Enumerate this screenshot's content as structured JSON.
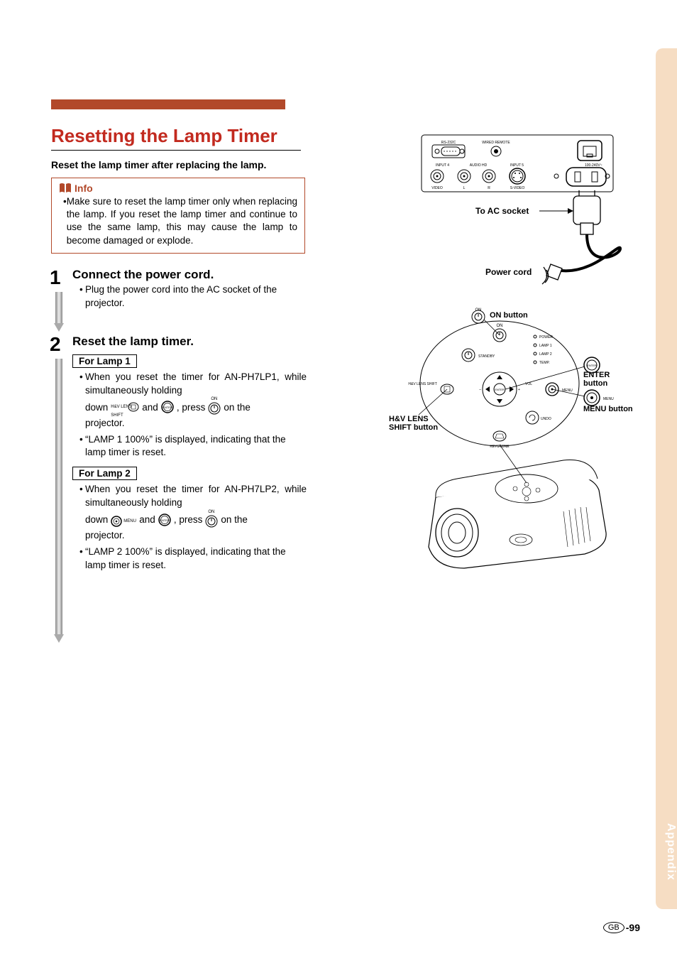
{
  "section_tab": "Appendix",
  "title": "Resetting the Lamp Timer",
  "subtitle": "Reset the lamp timer after replacing the lamp.",
  "info": {
    "label": "Info",
    "text": "Make sure to reset the lamp timer only when replacing the lamp. If you reset the lamp timer and continue to use the same lamp, this may cause the lamp to become damaged or explode."
  },
  "steps": [
    {
      "num": "1",
      "title": "Connect the power cord.",
      "bullets": [
        "Plug the power cord into the AC socket of the projector."
      ]
    },
    {
      "num": "2",
      "title": "Reset the lamp timer.",
      "lamp1": {
        "label": "For Lamp 1",
        "b1a": "When you reset the timer for AN-PH7LP1, while simultaneously holding",
        "b1b_pre": "down",
        "b1b_mid": "and",
        "b1b_press": ", press",
        "b1b_on": "ON",
        "b1b_post": "on the",
        "b1c": "projector.",
        "b2": "“LAMP 1 100%” is displayed, indicating that the lamp timer is reset."
      },
      "lamp2": {
        "label": "For Lamp 2",
        "b1a": "When you reset the timer for AN-PH7LP2, while simultaneously holding",
        "b1b_pre": "down",
        "b1b_mid": "and",
        "b1b_press": ", press",
        "b1b_on": "ON",
        "b1b_post": "on the",
        "b1c": "projector.",
        "b2": "“LAMP 2 100%” is displayed, indicating that the lamp timer is reset."
      }
    }
  ],
  "diagram1": {
    "to_ac": "To AC socket",
    "power_cord": "Power cord",
    "port_labels": {
      "rs232c": "RS-232C",
      "wired_remote": "WIRED REMOTE",
      "input4": "INPUT 4",
      "audio_hd": "AUDIO HD",
      "input5": "INPUT 5",
      "ac": "100-240V~",
      "video": "VIDEO",
      "l": "L",
      "r": "R",
      "svideo": "S-VIDEO"
    }
  },
  "diagram2": {
    "on_button": "ON button",
    "enter_button": "ENTER button",
    "menu_button": "MENU button",
    "lens_shift": "H&V LENS SHIFT button",
    "small": {
      "on": "ON",
      "power": "POWER",
      "lamp1": "LAMP 1",
      "lamp2": "LAMP 2",
      "temp": "TEMP.",
      "standby": "STANDBY",
      "enter": "ENTER",
      "lens": "H&V LENS SHIFT",
      "vol": "VOL",
      "menu": "MENU",
      "undo": "UNDO",
      "keystone": "KEYSTONE"
    }
  },
  "inline_icons": {
    "lens_shift": "H&V LENS SHIFT",
    "enter": "ENTER",
    "menu": "MENU",
    "on": "ON"
  },
  "footer": {
    "gb": "GB",
    "page": "-99"
  }
}
